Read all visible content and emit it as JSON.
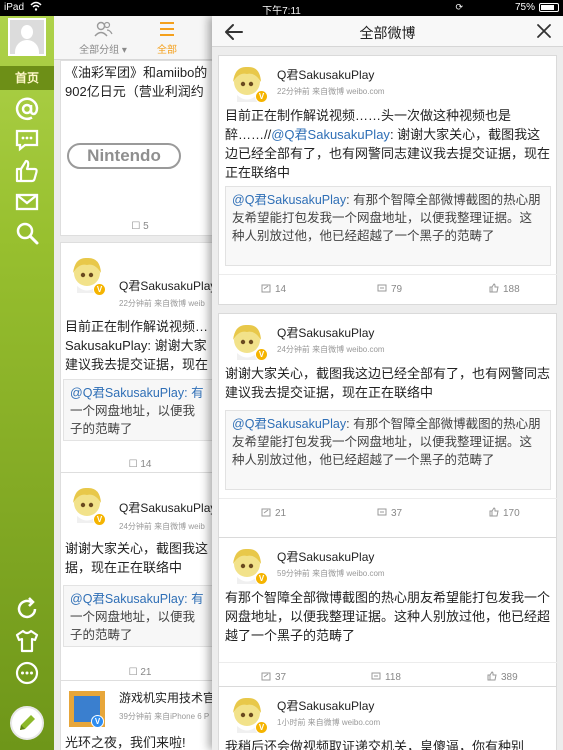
{
  "status": {
    "device": "iPad",
    "time": "下午7:11",
    "battery": "75%"
  },
  "sidebar": {
    "home_label": "首页",
    "icons": [
      "at-icon",
      "message-icon",
      "thumbs-up-icon",
      "mail-icon",
      "search-icon",
      "refresh-icon",
      "tshirt-icon",
      "more-icon"
    ]
  },
  "bgfeed": {
    "tabs": [
      {
        "label": "全部分组 ▾"
      },
      {
        "label": "全部"
      }
    ],
    "cards": [
      {
        "text_lines": [
          "《油彩军团》和amiibo的",
          "902亿日元（营业利润约"
        ],
        "logo": "Nintendo",
        "repost": "5"
      },
      {
        "name": "Q君SakusakuPlay",
        "meta": "22分钟前  来自微博 weib",
        "text_lines": [
          "目前正在制作解说视频…",
          "SakusakuPlay: 谢谢大家",
          "建议我去提交证据，现在"
        ],
        "quote_lines": [
          "@Q君SakusakuPlay: 有",
          "一个网盘地址，以便我",
          "子的范畴了"
        ],
        "repost": "14"
      },
      {
        "name": "Q君SakusakuPlay",
        "meta": "24分钟前  来自微博 weib",
        "text_lines": [
          "谢谢大家关心，截图我这",
          "据，现在正在联络中"
        ],
        "quote_lines": [
          "@Q君SakusakuPlay: 有",
          "一个网盘地址，以便我",
          "子的范畴了"
        ],
        "repost": "21"
      },
      {
        "name": "游戏机实用技术官",
        "meta": "39分钟前  来自iPhone 6 P",
        "text_lines": [
          "光环之夜，我们来啦!"
        ]
      }
    ]
  },
  "panel": {
    "title": "全部微博",
    "posts": [
      {
        "name": "Q君SakusakuPlay",
        "meta": "22分钟前  来自微博 weibo.com",
        "text_pre": "目前正在制作解说视频……头一次做这种视频也是醉……//",
        "text_mention": "@Q君SakusakuPlay",
        "text_post": ": 谢谢大家关心，截图我这边已经全部有了，也有网警同志建议我去提交证据，现在正在联络中",
        "quote_mention": "@Q君SakusakuPlay",
        "quote_text": ": 有那个智障全部微博截图的热心朋友希望能打包发我一个网盘地址，以便我整理证据。这种人别放过他，他已经超越了一个黑子的范畴了",
        "repost": "14",
        "comment": "79",
        "like": "188"
      },
      {
        "name": "Q君SakusakuPlay",
        "meta": "24分钟前  来自微博 weibo.com",
        "text_pre": "谢谢大家关心，截图我这边已经全部有了，也有网警同志建议我去提交证据，现在正在联络中",
        "text_mention": "",
        "text_post": "",
        "quote_mention": "@Q君SakusakuPlay",
        "quote_text": ": 有那个智障全部微博截图的热心朋友希望能打包发我一个网盘地址，以便我整理证据。这种人别放过他，他已经超越了一个黑子的范畴了",
        "repost": "21",
        "comment": "37",
        "like": "170"
      },
      {
        "name": "Q君SakusakuPlay",
        "meta": "59分钟前  来自微博 weibo.com",
        "text_pre": "有那个智障全部微博截图的热心朋友希望能打包发我一个网盘地址，以便我整理证据。这种人别放过他，他已经超越了一个黑子的范畴了",
        "text_mention": "",
        "text_post": "",
        "repost": "37",
        "comment": "118",
        "like": "389"
      },
      {
        "name": "Q君SakusakuPlay",
        "meta": "1小时前  来自微博 weibo.com",
        "text_pre": "我稍后还会做视频取证递交机关，皇傻逼，你有种别",
        "text_mention": "",
        "text_post": ""
      }
    ]
  }
}
